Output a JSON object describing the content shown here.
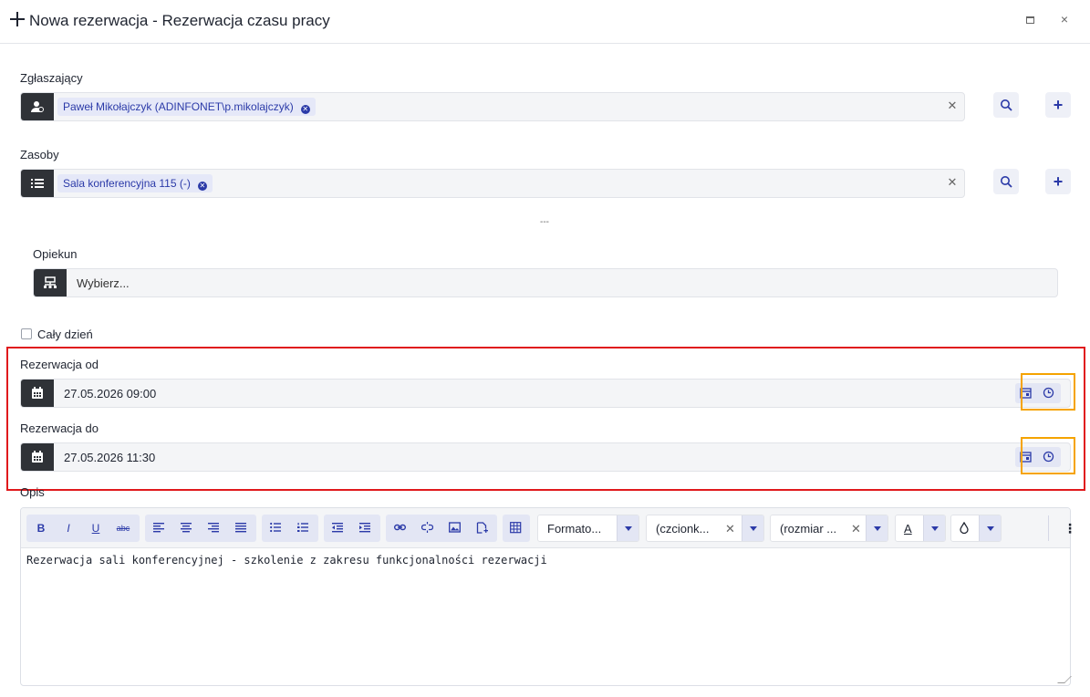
{
  "window": {
    "title": "Nowa rezerwacja - Rezerwacja czasu pracy",
    "maximize_label": "maximize",
    "close_label": "×"
  },
  "requester": {
    "label": "Zgłaszający",
    "chip": "Paweł Mikołajczyk (ADINFONET\\p.mikolajczyk)"
  },
  "resources": {
    "label": "Zasoby",
    "chip": "Sala konferencyjna 115 (-)"
  },
  "separator": "---",
  "guardian": {
    "label": "Opiekun",
    "placeholder": "Wybierz..."
  },
  "all_day": {
    "label": "Cały dzień",
    "checked": false
  },
  "reservation_from": {
    "label": "Rezerwacja od",
    "value": "27.05.2026 09:00"
  },
  "reservation_to": {
    "label": "Rezerwacja do",
    "value": "27.05.2026 11:30"
  },
  "description": {
    "label": "Opis",
    "content": "Rezerwacja sali konferencyjnej - szkolenie z zakresu funkcjonalności rezerwacji",
    "toolbar": {
      "bold": "B",
      "italic": "I",
      "underline": "U",
      "strike": "abc",
      "format_select": "Formato...",
      "font_select": "(czcionk...",
      "size_select": "(rozmiar ...",
      "font_color": "A",
      "more": "⋮"
    }
  },
  "colors": {
    "accent": "#2b3aa8",
    "highlight_red": "#e0191c",
    "highlight_orange": "#f5a300",
    "icon_dark": "#2f3237"
  }
}
